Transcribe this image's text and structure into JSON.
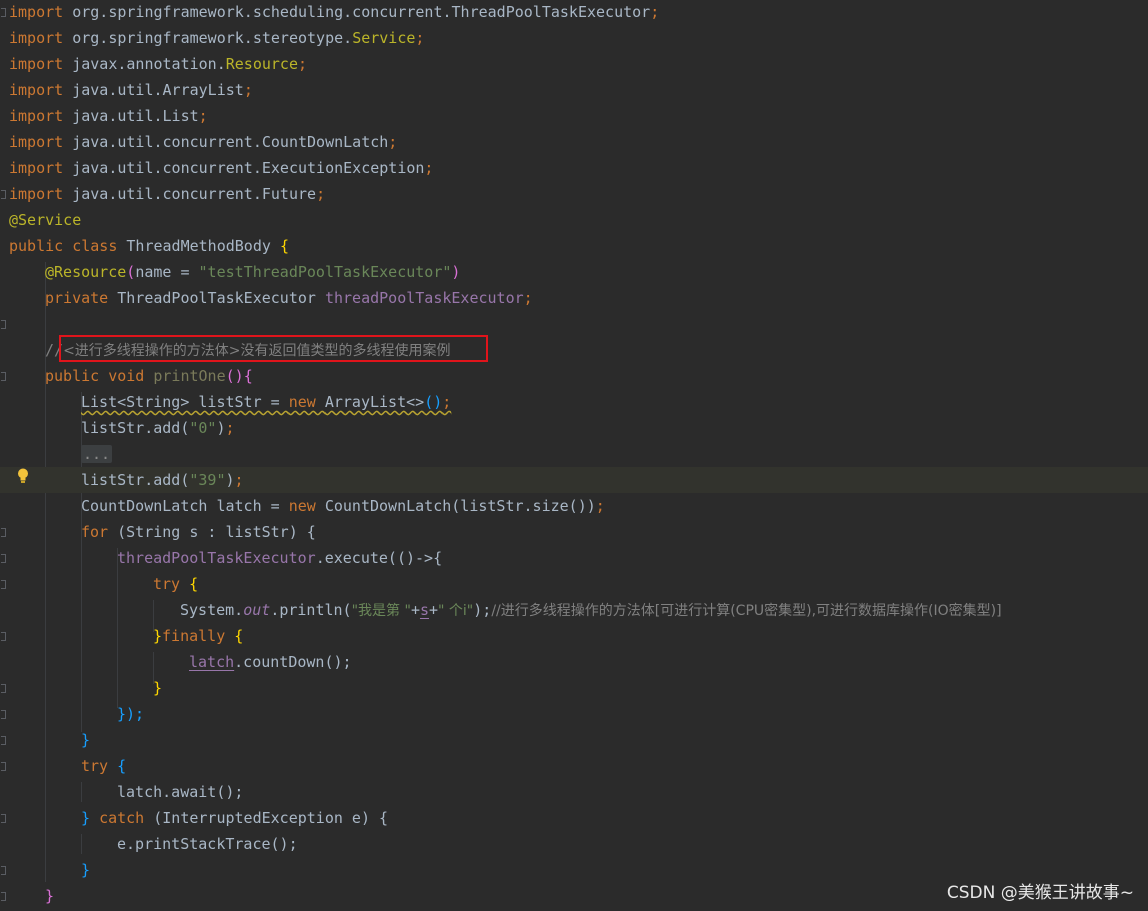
{
  "editor": {
    "imports": [
      {
        "kw": "import",
        "path": "org.springframework.scheduling.concurrent.ThreadPoolTaskExecutor"
      },
      {
        "kw": "import",
        "path": "org.springframework.stereotype.",
        "cls": "Service"
      },
      {
        "kw": "import",
        "path": "javax.annotation.",
        "cls": "Resource"
      },
      {
        "kw": "import",
        "path": "java.util.ArrayList"
      },
      {
        "kw": "import",
        "path": "java.util.List"
      },
      {
        "kw": "import",
        "path": "java.util.concurrent.CountDownLatch"
      },
      {
        "kw": "import",
        "path": "java.util.concurrent.ExecutionException"
      },
      {
        "kw": "import",
        "path": "java.util.concurrent.Future"
      }
    ],
    "service_annotation": "@Service",
    "class_decl": {
      "mods": "public class ",
      "name": "ThreadMethodBody"
    },
    "resource_annotation": "@Resource",
    "resource_arg_name": "name",
    "resource_arg_value": "\"testThreadPoolTaskExecutor\"",
    "field_decl": {
      "mod": "private ",
      "type": "ThreadPoolTaskExecutor ",
      "name": "threadPoolTaskExecutor"
    },
    "comment_prefix": "//",
    "comment_text": "<进行多线程操作的方法体>没有返回值类型的多线程使用案例",
    "method_decl": {
      "mods": "public void ",
      "name": "printOne"
    },
    "list_decl": {
      "type": "List<String> listStr = ",
      "new": "new ",
      "ctor": "ArrayList<>"
    },
    "add0": {
      "call": "listStr.add(",
      "arg": "\"0\""
    },
    "folded": "...",
    "add39": {
      "call": "listStr.add(",
      "arg": "\"39\""
    },
    "latch_decl": {
      "type": "CountDownLatch latch = ",
      "new": "new ",
      "ctor": "CountDownLatch(listStr.size())"
    },
    "for_stmt": {
      "kw": "for ",
      "body": "(String s : listStr) {"
    },
    "execute_call": {
      "field": "threadPoolTaskExecutor",
      "rest": ".execute(()->{"
    },
    "try_kw": "try",
    "println": {
      "sys": "System.",
      "out": "out",
      "call": ".println(",
      "s1": "\"我是第 \"",
      "plus1": "+",
      "var": "s",
      "plus2": "+",
      "s2": "\" 个i\"",
      "end": ");",
      "comment": "//进行多线程操作的方法体[可进行计算(CPU密集型),可进行数据库操作(IO密集型)]"
    },
    "finally_kw": "finally",
    "countdown": {
      "var": "latch",
      "rest": ".countDown();"
    },
    "close_lambda": "});",
    "await_call": "latch.await();",
    "catch_kw": "catch",
    "catch_args": "(InterruptedException e) {",
    "print_trace": "e.printStackTrace();"
  },
  "watermark": "CSDN @美猴王讲故事~",
  "icons": {
    "lightbulb": "lightbulb-icon"
  },
  "colors": {
    "highlight_box": "#e0141b",
    "background": "#2b2b2b"
  }
}
